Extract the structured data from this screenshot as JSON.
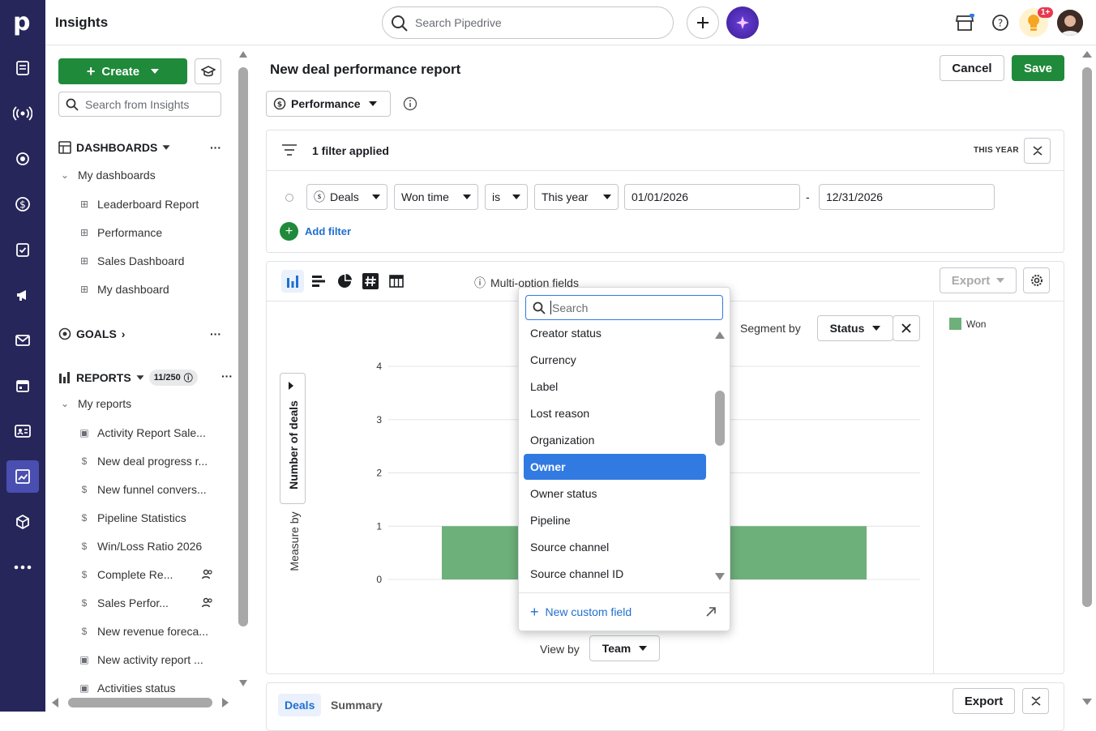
{
  "app": {
    "title": "Insights"
  },
  "topbar": {
    "search_placeholder": "Search Pipedrive",
    "notification_badge": "1+"
  },
  "sidebar": {
    "create_label": "Create",
    "search_placeholder": "Search from Insights",
    "dashboards": {
      "label": "DASHBOARDS",
      "group": "My dashboards",
      "items": [
        "Leaderboard Report",
        "Performance",
        "Sales Dashboard",
        "My dashboard"
      ]
    },
    "goals": {
      "label": "GOALS"
    },
    "reports": {
      "label": "REPORTS",
      "count": "11/250",
      "group": "My reports",
      "items": [
        {
          "label": "Activity Report Sale...",
          "icon": "calendar-icon"
        },
        {
          "label": "New deal progress r...",
          "icon": "dollar-icon"
        },
        {
          "label": "New funnel convers...",
          "icon": "dollar-icon"
        },
        {
          "label": "Pipeline Statistics",
          "icon": "dollar-icon"
        },
        {
          "label": "Win/Loss Ratio 2026",
          "icon": "dollar-icon"
        },
        {
          "label": "Complete Re...",
          "icon": "dollar-icon",
          "shared": true
        },
        {
          "label": "Sales Perfor...",
          "icon": "dollar-icon",
          "shared": true
        },
        {
          "label": "New revenue foreca...",
          "icon": "forecast-icon"
        },
        {
          "label": "New activity report ...",
          "icon": "calendar-icon"
        },
        {
          "label": "Activities status",
          "icon": "calendar-icon"
        }
      ]
    }
  },
  "report": {
    "title": "New deal performance report",
    "cancel_label": "Cancel",
    "save_label": "Save",
    "type_label": "Performance",
    "filters": {
      "summary": "1 filter applied",
      "period_tag": "THIS YEAR",
      "entity": "Deals",
      "field": "Won time",
      "operator": "is",
      "period": "This year",
      "from": "01/01/2026",
      "dash": "-",
      "to": "12/31/2026",
      "add_label": "Add filter"
    },
    "chart_toolbar": {
      "multi_option_label": "Multi-option fields",
      "export_label": "Export"
    },
    "segment_by_label": "Segment by",
    "segment_value": "Status",
    "measure_by_label": "Measure by",
    "measure_value": "Number of deals",
    "view_by_label": "View by",
    "view_value": "Team",
    "bottom_tabs": [
      "Deals",
      "Summary"
    ],
    "bottom_export_label": "Export"
  },
  "dropdown": {
    "search_placeholder": "Search",
    "options": [
      "Creator status",
      "Currency",
      "Label",
      "Lost reason",
      "Organization",
      "Owner",
      "Owner status",
      "Pipeline",
      "Source channel",
      "Source channel ID"
    ],
    "selected": "Owner",
    "footer_label": "New custom field"
  },
  "chart_data": {
    "type": "bar",
    "ylabel": "Number of deals",
    "ylim": [
      0,
      4
    ],
    "yticks": [
      "0",
      "1",
      "2",
      "3",
      "4"
    ],
    "series": [
      {
        "name": "Won",
        "values": [
          1,
          1
        ],
        "color": "#6db07a"
      }
    ]
  }
}
